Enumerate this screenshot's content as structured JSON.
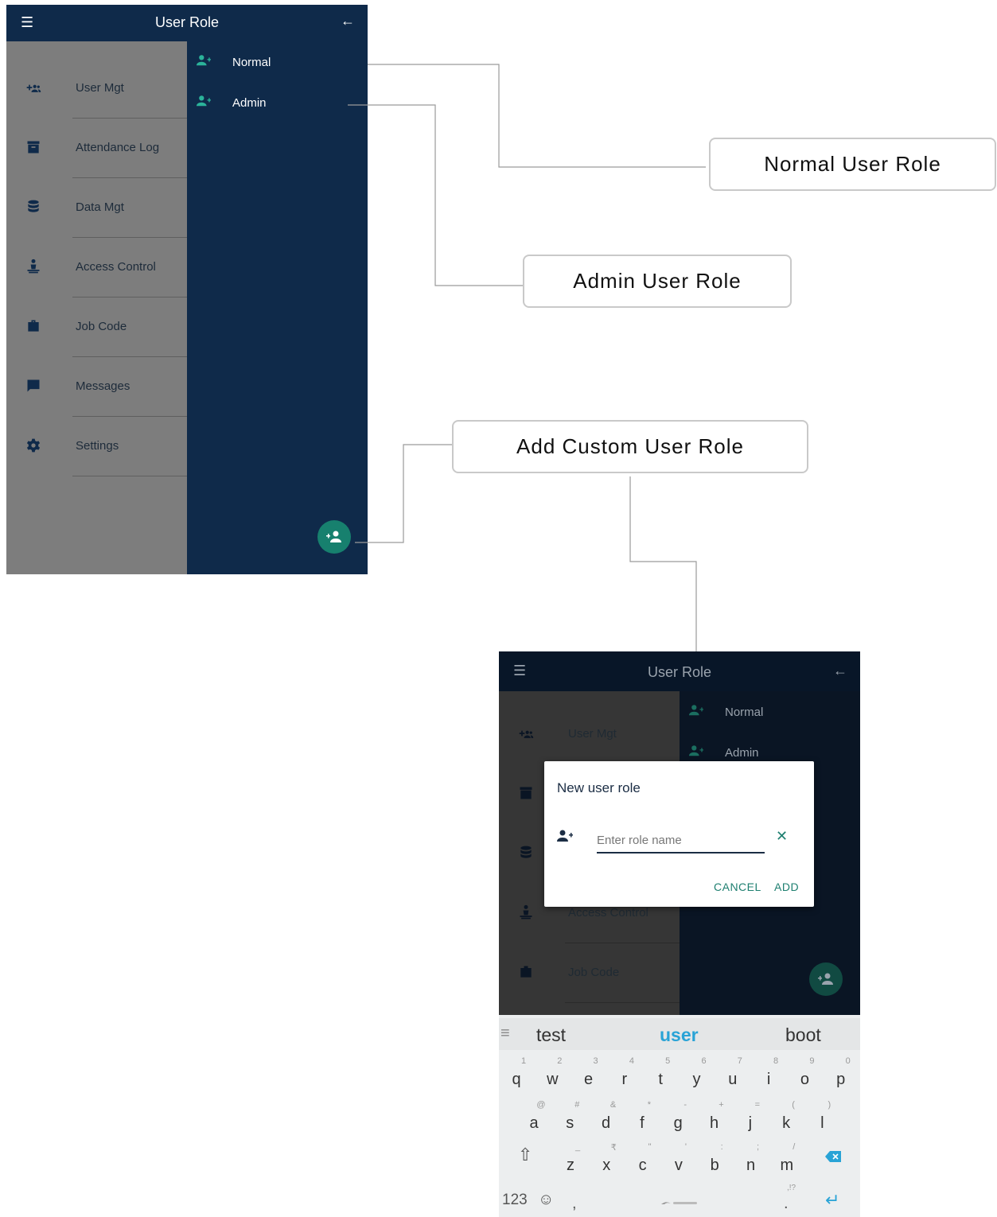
{
  "screen1": {
    "title": "User Role",
    "nav_items": [
      {
        "label": "User Mgt",
        "icon": "add-group-icon"
      },
      {
        "label": "Attendance Log",
        "icon": "archive-icon"
      },
      {
        "label": "Data Mgt",
        "icon": "database-icon"
      },
      {
        "label": "Access Control",
        "icon": "access-person-icon"
      },
      {
        "label": "Job Code",
        "icon": "briefcase-icon"
      },
      {
        "label": "Messages",
        "icon": "message-icon"
      },
      {
        "label": "Settings",
        "icon": "gear-icon"
      }
    ],
    "roles": [
      {
        "label": "Normal",
        "icon": "person-add-icon"
      },
      {
        "label": "Admin",
        "icon": "person-add-icon"
      }
    ]
  },
  "callouts": {
    "normal": "Normal User Role",
    "admin": "Admin User Role",
    "custom": "Add Custom User Role"
  },
  "screen2": {
    "title": "User Role",
    "nav_items": [
      {
        "label": "User Mgt"
      },
      {
        "label": "Access Control"
      },
      {
        "label": "Job Code"
      }
    ],
    "roles": [
      {
        "label": "Normal"
      },
      {
        "label": "Admin"
      }
    ],
    "dialog": {
      "title": "New user role",
      "placeholder": "Enter role name",
      "cancel": "CANCEL",
      "add": "ADD"
    },
    "keyboard": {
      "suggestions": [
        "test",
        "user",
        "boot"
      ],
      "row1": [
        [
          "q",
          "1"
        ],
        [
          "w",
          "2"
        ],
        [
          "e",
          "3"
        ],
        [
          "r",
          "4"
        ],
        [
          "t",
          "5"
        ],
        [
          "y",
          "6"
        ],
        [
          "u",
          "7"
        ],
        [
          "i",
          "8"
        ],
        [
          "o",
          "9"
        ],
        [
          "p",
          "0"
        ]
      ],
      "row2": [
        [
          "a",
          "@"
        ],
        [
          "s",
          "#"
        ],
        [
          "d",
          "&"
        ],
        [
          "f",
          "*"
        ],
        [
          "g",
          "-"
        ],
        [
          "h",
          "+"
        ],
        [
          "j",
          "="
        ],
        [
          "k",
          "("
        ],
        [
          "l",
          ")"
        ]
      ],
      "row3": [
        [
          "z",
          "_"
        ],
        [
          "x",
          "₹"
        ],
        [
          "c",
          "\""
        ],
        [
          "v",
          "'"
        ],
        [
          "b",
          ":"
        ],
        [
          "n",
          ";"
        ],
        [
          "m",
          "/"
        ]
      ],
      "numbers_key": "123",
      "comma": ",",
      "period": ".",
      "period_sub": ",!?"
    }
  },
  "colors": {
    "navy": "#0f2a4a",
    "teal": "#17806e",
    "accent_blue": "#29a3d6"
  }
}
